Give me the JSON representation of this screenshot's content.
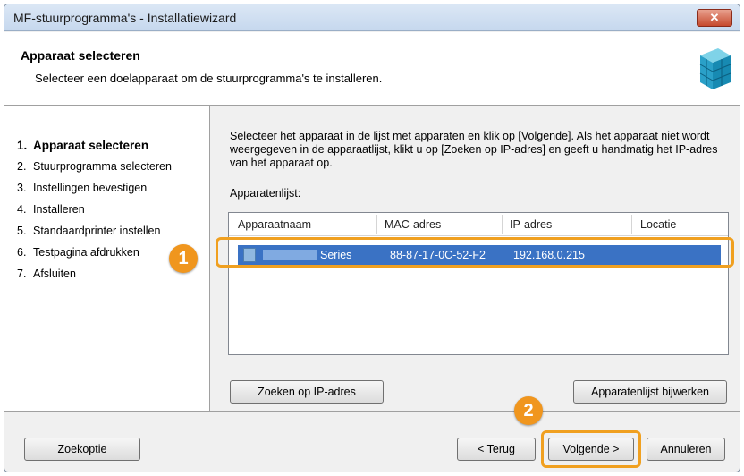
{
  "window": {
    "title": "MF-stuurprogramma's - Installatiewizard",
    "close_label": "✕"
  },
  "header": {
    "title": "Apparaat selecteren",
    "subtitle": "Selecteer een doelapparaat om de stuurprogramma's te installeren.",
    "icon": "printer-cube-icon"
  },
  "steps": [
    {
      "num": "1.",
      "label": "Apparaat selecteren",
      "active": true
    },
    {
      "num": "2.",
      "label": "Stuurprogramma selecteren"
    },
    {
      "num": "3.",
      "label": "Instellingen bevestigen"
    },
    {
      "num": "4.",
      "label": "Installeren"
    },
    {
      "num": "5.",
      "label": "Standaardprinter instellen"
    },
    {
      "num": "6.",
      "label": "Testpagina afdrukken"
    },
    {
      "num": "7.",
      "label": "Afsluiten"
    }
  ],
  "main": {
    "instruction": "Selecteer het apparaat in de lijst met apparaten en klik op [Volgende]. Als het apparaat niet wordt weergegeven in de apparaatlijst, klikt u op [Zoeken op IP-adres] en geeft u handmatig het IP-adres van het apparaat op.",
    "list_label": "Apparatenlijst:",
    "columns": [
      "Apparaatnaam",
      "MAC-adres",
      "IP-adres",
      "Locatie"
    ],
    "rows": [
      {
        "name": "Series",
        "mac": "88-87-17-0C-52-F2",
        "ip": "192.168.0.215",
        "location": ""
      }
    ],
    "search_ip_button": "Zoeken op IP-adres",
    "refresh_button": "Apparatenlijst bijwerken"
  },
  "footer": {
    "search_option_button": "Zoekoptie",
    "back_button": "< Terug",
    "next_button": "Volgende >",
    "cancel_button": "Annuleren"
  },
  "callouts": [
    "1",
    "2"
  ],
  "colors": {
    "accent": "#f0961e",
    "selection": "#3a72c4"
  }
}
